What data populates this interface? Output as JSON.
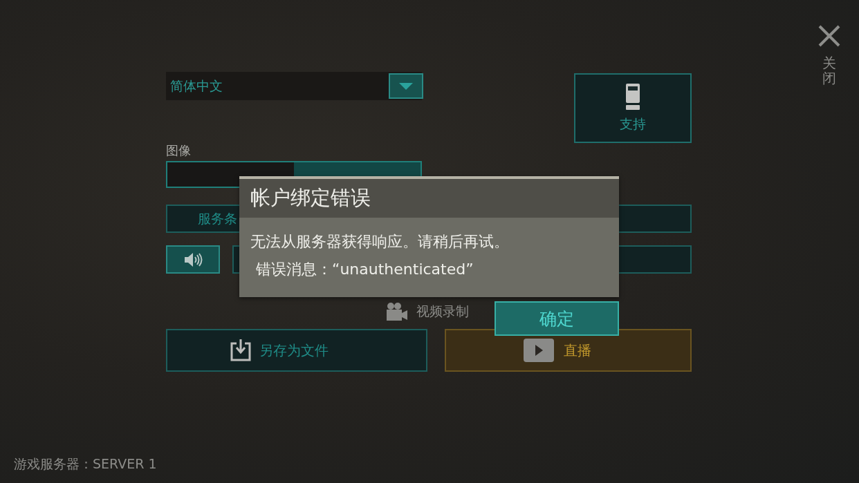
{
  "language_select": {
    "value": "简体中文"
  },
  "support_button": {
    "label": "支持"
  },
  "graphics": {
    "label": "图像"
  },
  "service_button": {
    "label": "服务条"
  },
  "video_record": {
    "label": "视频录制"
  },
  "save_button": {
    "label": "另存为文件"
  },
  "live_button": {
    "label": "直播"
  },
  "dialog": {
    "title": "帐户绑定错误",
    "message": "无法从服务器获得响应。请稍后再试。",
    "detail": "错误消息：“unauthenticated”",
    "ok_button": "确定"
  },
  "close": {
    "label": "关闭"
  },
  "status_bar": {
    "text": "游戏服务器：SERVER 1"
  }
}
